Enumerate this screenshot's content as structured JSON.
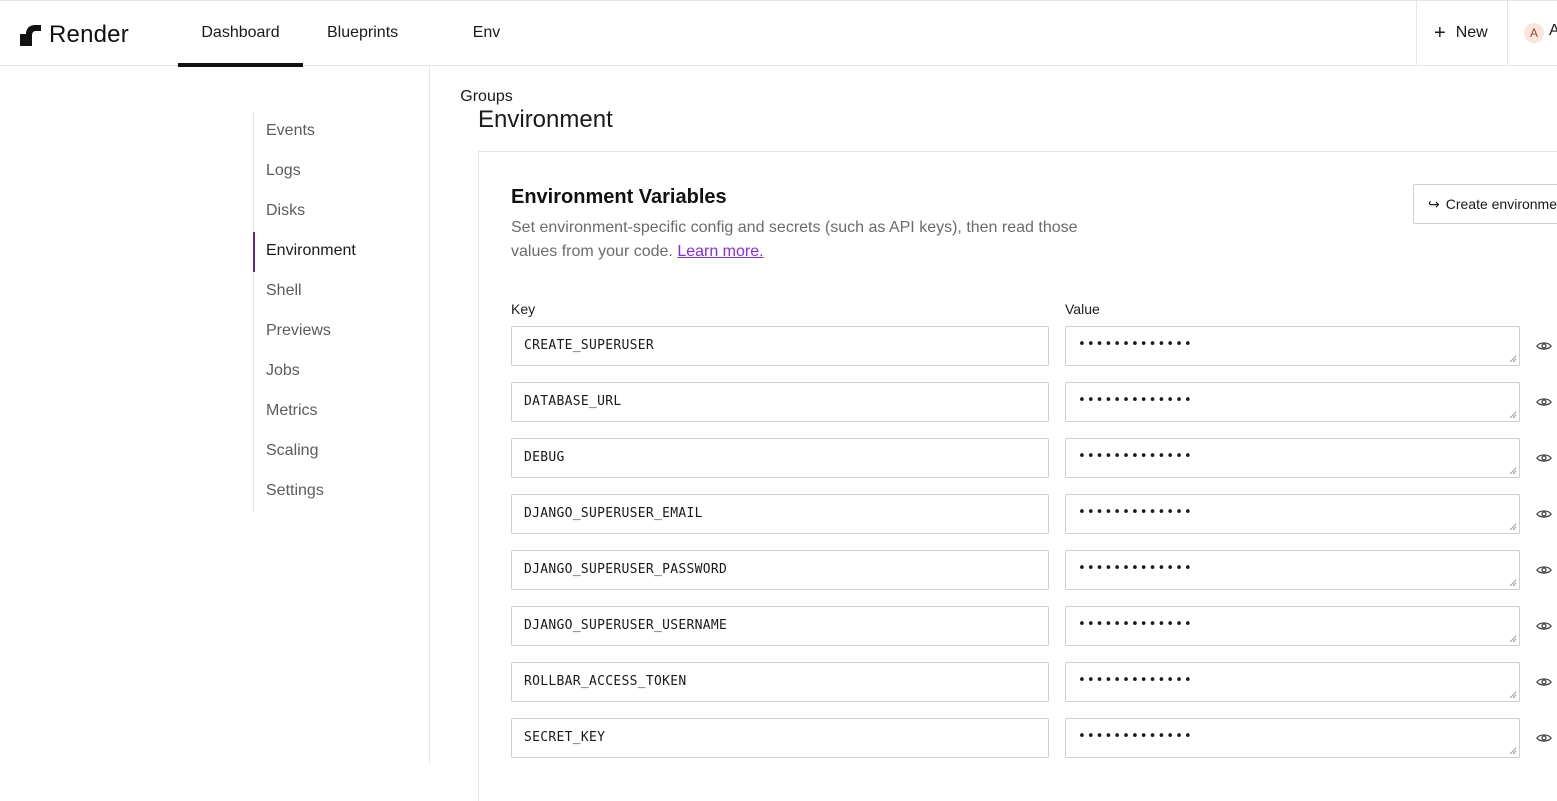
{
  "app": {
    "name": "Render"
  },
  "nav": {
    "tabs": [
      {
        "label": "Dashboard",
        "active": true
      },
      {
        "label": "Blueprints",
        "active": false
      },
      {
        "label": "Env Groups",
        "active": false
      }
    ],
    "new_label": "New",
    "avatar_initial": "A",
    "account_label": "A"
  },
  "sidebar": {
    "items": [
      {
        "label": "Events"
      },
      {
        "label": "Logs"
      },
      {
        "label": "Disks"
      },
      {
        "label": "Environment",
        "active": true
      },
      {
        "label": "Shell"
      },
      {
        "label": "Previews"
      },
      {
        "label": "Jobs"
      },
      {
        "label": "Metrics"
      },
      {
        "label": "Scaling"
      },
      {
        "label": "Settings"
      }
    ]
  },
  "main": {
    "title": "Environment",
    "env_vars": {
      "title": "Environment Variables",
      "description": "Set environment-specific config and secrets (such as API keys), then read those values from your code.",
      "learn_more": "Learn more.",
      "create_button": "Create environment group",
      "key_label": "Key",
      "value_label": "Value",
      "rows": [
        {
          "key": "CREATE_SUPERUSER",
          "value": "•••••••••••••"
        },
        {
          "key": "DATABASE_URL",
          "value": "•••••••••••••"
        },
        {
          "key": "DEBUG",
          "value": "•••••••••••••"
        },
        {
          "key": "DJANGO_SUPERUSER_EMAIL",
          "value": "•••••••••••••"
        },
        {
          "key": "DJANGO_SUPERUSER_PASSWORD",
          "value": "•••••••••••••"
        },
        {
          "key": "DJANGO_SUPERUSER_USERNAME",
          "value": "•••••••••••••"
        },
        {
          "key": "ROLLBAR_ACCESS_TOKEN",
          "value": "•••••••••••••"
        },
        {
          "key": "SECRET_KEY",
          "value": "•••••••••••••"
        }
      ]
    }
  },
  "colors": {
    "accent": "#6d1f8f",
    "link": "#8a2be2",
    "border": "#cfcfcf"
  }
}
